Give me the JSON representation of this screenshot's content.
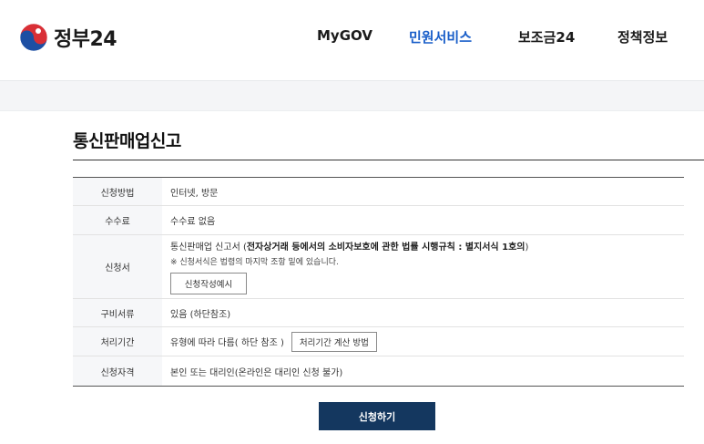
{
  "header": {
    "logo_text": "정부24",
    "nav": [
      {
        "label": "MyGOV"
      },
      {
        "label": "민원서비스"
      },
      {
        "label": "보조금24"
      },
      {
        "label": "정책정보"
      }
    ],
    "active_nav": "민원서비스",
    "colors": {
      "active": "#1a5fc9",
      "logo_red": "#d92f36",
      "logo_blue": "#1d4fa3"
    }
  },
  "page": {
    "title": "통신판매업신고"
  },
  "table": {
    "rows": [
      {
        "label": "신청방법",
        "value": "인터넷, 방문"
      },
      {
        "label": "수수료",
        "value": "수수료 없음"
      },
      {
        "label": "신청서",
        "value_prefix": "통신판매업 신고서 (",
        "value_law": "전자상거래 등에서의 소비자보호에 관한 법률 시행규칙 : 별지서식 1호의",
        "value_suffix": ")",
        "note": "※ 신청서식은 법령의 마지막 조항 밑에 있습니다.",
        "button": "신청작성예시"
      },
      {
        "label": "구비서류",
        "value": "있음 (하단참조)"
      },
      {
        "label": "처리기간",
        "value": "유형에 따라 다름( 하단 참조 )",
        "button": "처리기간 계산 방법"
      },
      {
        "label": "신청자격",
        "value": "본인 또는 대리인(온라인은 대리인 신청 불가)"
      }
    ]
  },
  "apply_button": "신청하기",
  "apply_color": "#14375f"
}
